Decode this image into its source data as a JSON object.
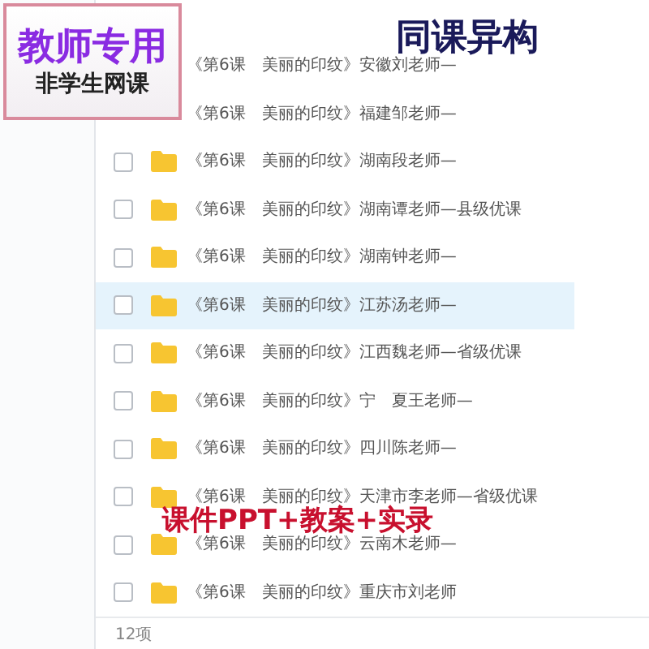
{
  "files": [
    {
      "name": "《第6课　美丽的印纹》安徽刘老师—",
      "highlighted": false
    },
    {
      "name": "《第6课　美丽的印纹》福建邹老师—",
      "highlighted": false
    },
    {
      "name": "《第6课　美丽的印纹》湖南段老师—",
      "checked": false,
      "highlighted": false
    },
    {
      "name": "《第6课　美丽的印纹》湖南谭老师—县级优课",
      "checked": false,
      "highlighted": false
    },
    {
      "name": "《第6课　美丽的印纹》湖南钟老师—",
      "checked": false,
      "highlighted": false
    },
    {
      "name": "《第6课　美丽的印纹》江苏汤老师—",
      "checked": false,
      "highlighted": true
    },
    {
      "name": "《第6课　美丽的印纹》江西魏老师—省级优课",
      "checked": false,
      "highlighted": false
    },
    {
      "name": "《第6课　美丽的印纹》宁　夏王老师—",
      "checked": false,
      "highlighted": false
    },
    {
      "name": "《第6课　美丽的印纹》四川陈老师—",
      "checked": false,
      "highlighted": false
    },
    {
      "name": "《第6课　美丽的印纹》天津市李老师—省级优课",
      "checked": false,
      "highlighted": false
    },
    {
      "name": "《第6课　美丽的印纹》云南木老师—",
      "checked": false,
      "highlighted": false
    },
    {
      "name": "《第6课　美丽的印纹》重庆市刘老师",
      "checked": false,
      "highlighted": false
    }
  ],
  "status_bar": {
    "count": "12项"
  },
  "overlays": {
    "badge_title": "教师专用",
    "badge_subtitle": "非学生网课",
    "heading": "同课异构",
    "caption": "课件PPT+教案+实录"
  }
}
